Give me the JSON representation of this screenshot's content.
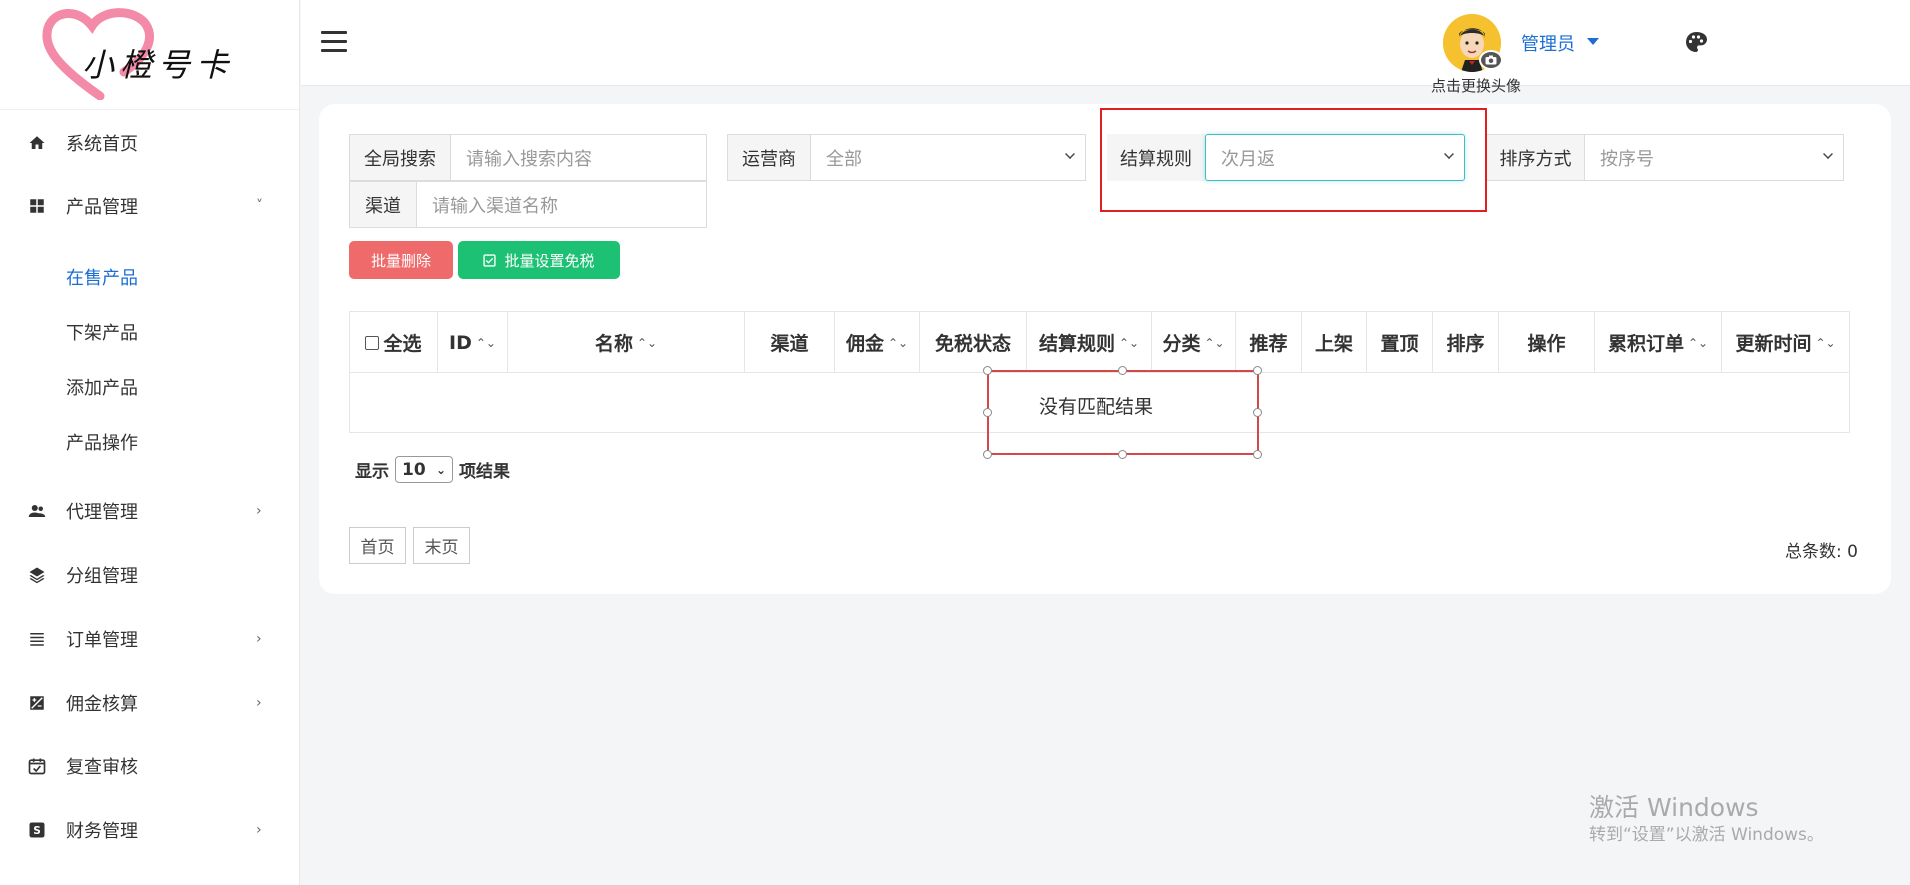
{
  "brand": {
    "name": "小橙号卡"
  },
  "sidebar": {
    "items": [
      {
        "label": "系统首页",
        "icon": "home-icon",
        "chevron": ""
      },
      {
        "label": "产品管理",
        "icon": "grid-icon",
        "chevron": "˅"
      },
      {
        "label": "代理管理",
        "icon": "people-icon",
        "chevron": "›"
      },
      {
        "label": "分组管理",
        "icon": "layers-icon",
        "chevron": ""
      },
      {
        "label": "订单管理",
        "icon": "list-icon",
        "chevron": "›"
      },
      {
        "label": "佣金核算",
        "icon": "exposure-icon",
        "chevron": "›"
      },
      {
        "label": "复查审核",
        "icon": "calendar-check-icon",
        "chevron": ""
      },
      {
        "label": "财务管理",
        "icon": "dollar-icon",
        "chevron": "›"
      }
    ],
    "subitems": [
      "在售产品",
      "下架产品",
      "添加产品",
      "产品操作"
    ]
  },
  "header": {
    "avatar_caption": "点击更换头像",
    "user_name": "管理员"
  },
  "filters": {
    "global_label": "全局搜索",
    "global_placeholder": "请输入搜索内容",
    "operator_label": "运营商",
    "operator_value": "全部",
    "settle_label": "结算规则",
    "settle_value": "次月返",
    "sort_label": "排序方式",
    "sort_value": "按序号",
    "channel_label": "渠道",
    "channel_placeholder": "请输入渠道名称"
  },
  "actions": {
    "batch_delete": "批量删除",
    "batch_taxfree": "批量设置免税"
  },
  "table": {
    "columns": [
      {
        "label": "全选",
        "sortable": false
      },
      {
        "label": "ID",
        "sortable": true
      },
      {
        "label": "名称",
        "sortable": true
      },
      {
        "label": "渠道",
        "sortable": false
      },
      {
        "label": "佣金",
        "sortable": true
      },
      {
        "label": "免税状态",
        "sortable": false
      },
      {
        "label": "结算规则",
        "sortable": true
      },
      {
        "label": "分类",
        "sortable": true
      },
      {
        "label": "推荐",
        "sortable": false
      },
      {
        "label": "上架",
        "sortable": false
      },
      {
        "label": "置顶",
        "sortable": false
      },
      {
        "label": "排序",
        "sortable": false
      },
      {
        "label": "操作",
        "sortable": false
      },
      {
        "label": "累积订单",
        "sortable": true
      },
      {
        "label": "更新时间",
        "sortable": true
      }
    ],
    "empty_text": "没有匹配结果"
  },
  "pagination": {
    "show_label": "显示",
    "page_size": "10",
    "suffix_label": "项结果",
    "first": "首页",
    "last": "末页",
    "total": "总条数: 0"
  },
  "watermark": {
    "line1": "激活 Windows",
    "line2": "转到“设置”以激活 Windows。"
  },
  "colors": {
    "accent": "#1b6ed6",
    "danger": "#ef6a6a",
    "success": "#1dc174",
    "highlight": "#e02020"
  }
}
